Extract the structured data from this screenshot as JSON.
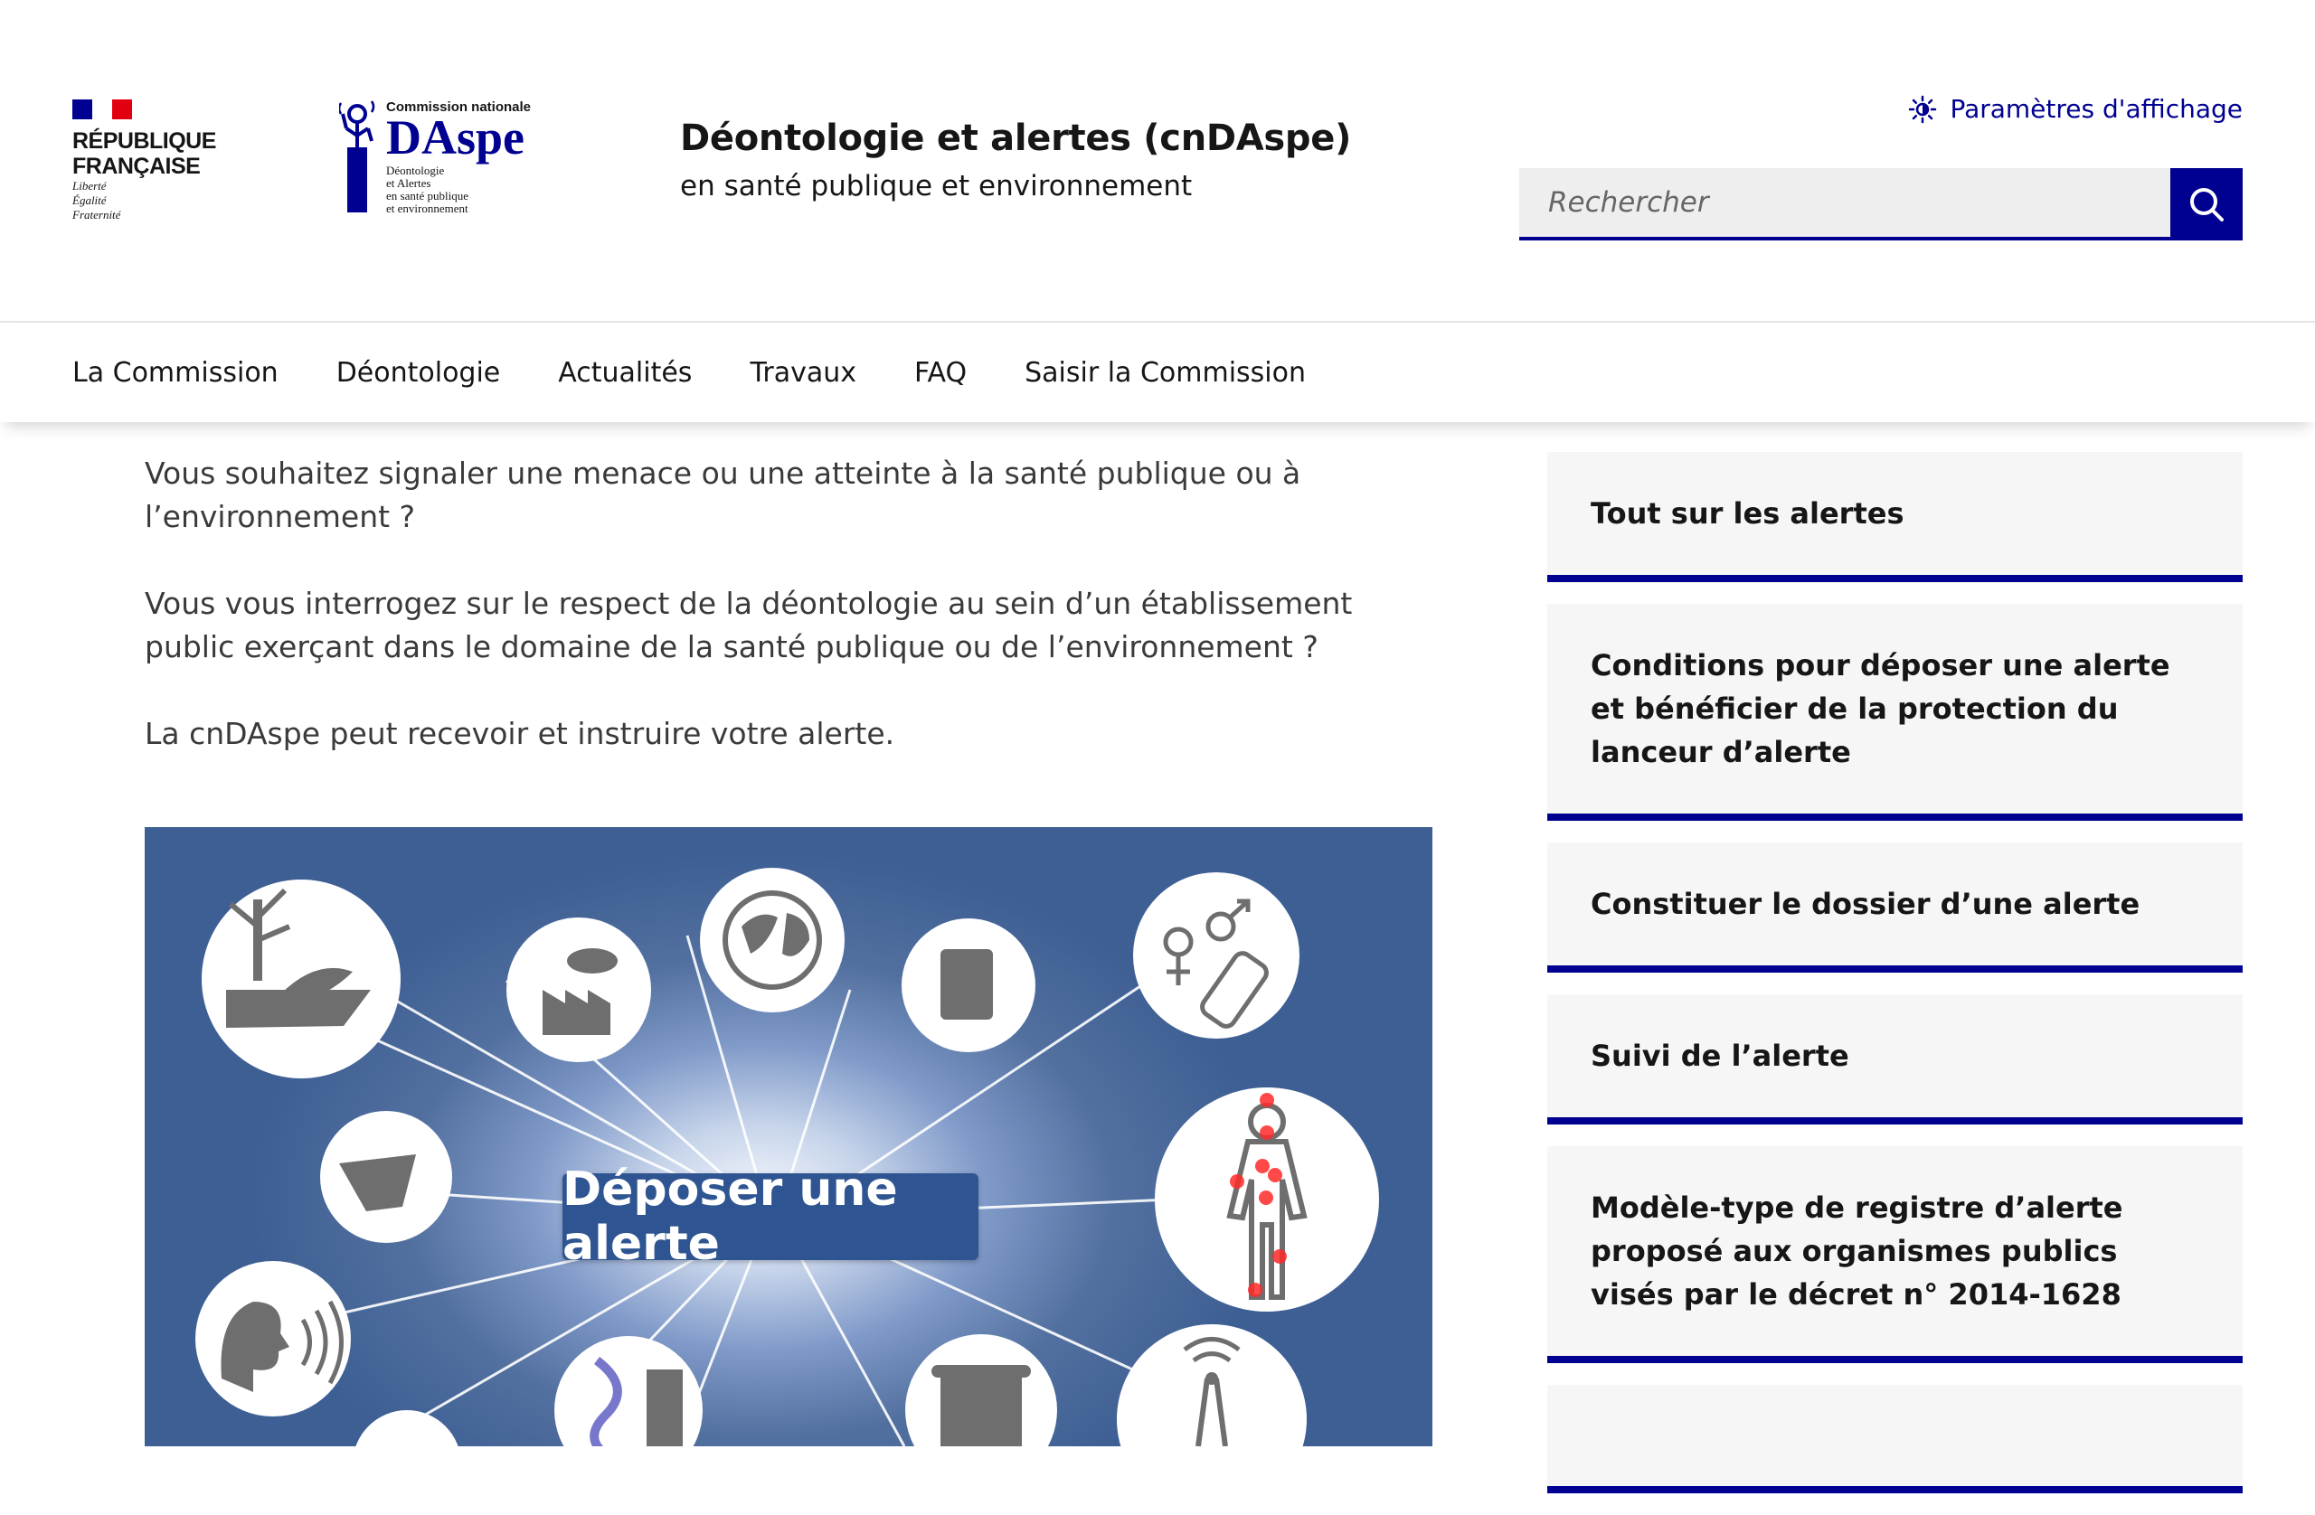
{
  "header": {
    "rf_name_line1": "RÉPUBLIQUE",
    "rf_name_line2": "FRANÇAISE",
    "rf_motto1": "Liberté",
    "rf_motto2": "Égalité",
    "rf_motto3": "Fraternité",
    "cnd_top": "Commission nationale",
    "cnd_name": "DAspe",
    "cnd_sub1": "Déontologie",
    "cnd_sub2": "et Alertes",
    "cnd_sub3": "en santé publique",
    "cnd_sub4": "et environnement",
    "site_title": "Déontologie et alertes (cnDAspe)",
    "site_tagline": "en santé publique et environnement",
    "display_params": "Paramètres d'affichage",
    "search_placeholder": "Rechercher"
  },
  "nav": {
    "items": [
      "La Commission",
      "Déontologie",
      "Actualités",
      "Travaux",
      "FAQ",
      "Saisir la Commission"
    ]
  },
  "main": {
    "para1": "Vous souhaitez signaler une menace ou une atteinte à la santé publique ou à l’environnement ?",
    "para2": "Vous vous interrogez sur le respect de la déontologie au sein d’un établissement public exerçant dans le domaine de la santé publique ou de l’environnement ?",
    "para3": "La cnDAspe peut recevoir et instruire votre alerte.",
    "hero_button": "Déposer une alerte"
  },
  "sidebar": {
    "cards": [
      "Tout sur les alertes",
      "Conditions pour déposer une alerte et bénéficier de la protection du lanceur d’alerte",
      "Constituer le dossier d’une alerte",
      "Suivi de l’alerte",
      "Modèle-type de registre d’alerte proposé aux organismes publics visés par le décret n° 2014-1628"
    ]
  },
  "colors": {
    "primary": "#000091",
    "flag_blue": "#000091",
    "flag_red": "#e1000f",
    "hero_button": "#2e5591"
  }
}
